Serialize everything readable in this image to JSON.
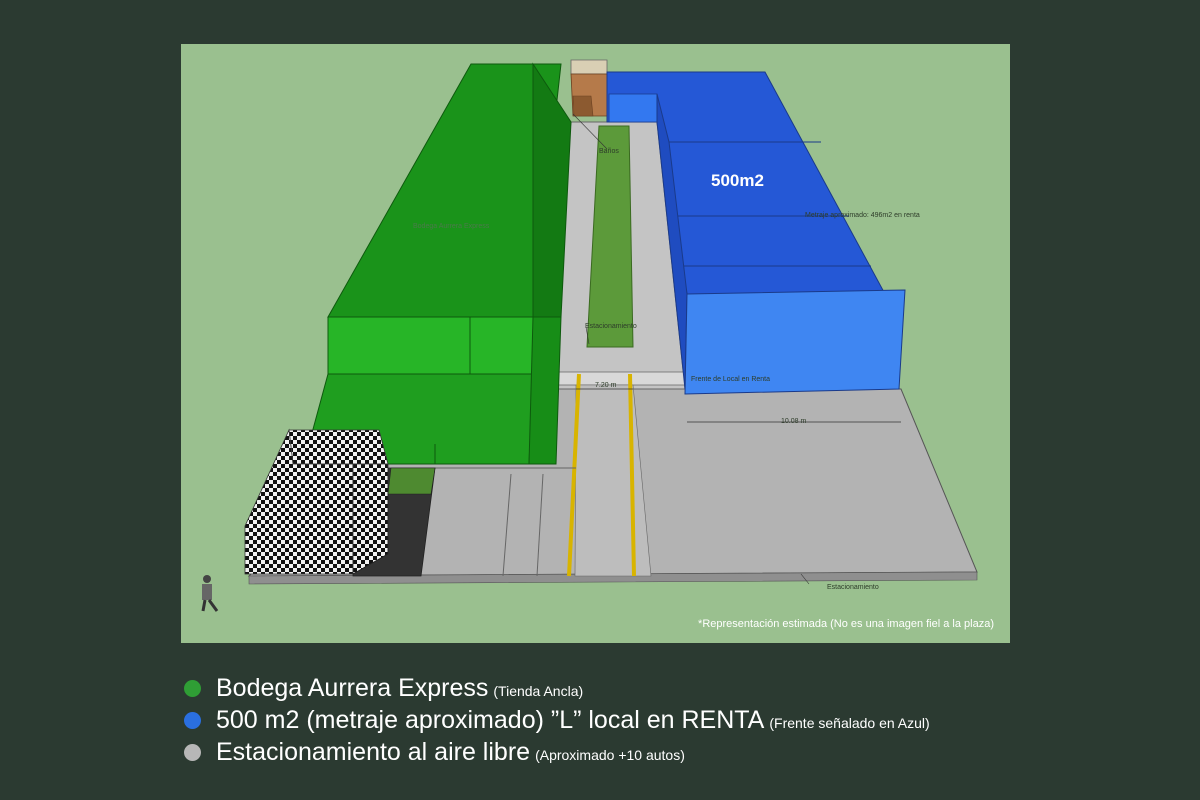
{
  "colors": {
    "background": "#2b3a31",
    "panel": "#9ac08f",
    "bodega_green": "#1f9e1f",
    "local_blue": "#2f6ee8",
    "parking_gray": "#b9b9b9"
  },
  "render": {
    "labels": {
      "banos": "Baños",
      "area": "500m2",
      "metraje": "Metraje aproximado: 496m2 en renta",
      "bodega": "Bodega Aurrera Express",
      "estacionamiento_top": "Estacionamiento",
      "width_720": "7.20 m",
      "frente": "Frente de Local en Renta",
      "width_1008": "10.08 m",
      "estacionamiento_bottom": "Estacionamiento"
    },
    "disclaimer": "*Representación estimada (No es una imagen fiel a la plaza)"
  },
  "legend": [
    {
      "icon": "green-dot-icon",
      "color": "#2f9e35",
      "main": "Bodega Aurrera Express",
      "note": "(Tienda Ancla)"
    },
    {
      "icon": "blue-dot-icon",
      "color": "#2a6fe0",
      "main": "500 m2 (metraje aproximado) ”L” local en RENTA",
      "note": "(Frente señalado en Azul)"
    },
    {
      "icon": "gray-dot-icon",
      "color": "#b7b7b7",
      "main": "Estacionamiento al aire libre",
      "note": "(Aproximado +10 autos)"
    }
  ]
}
